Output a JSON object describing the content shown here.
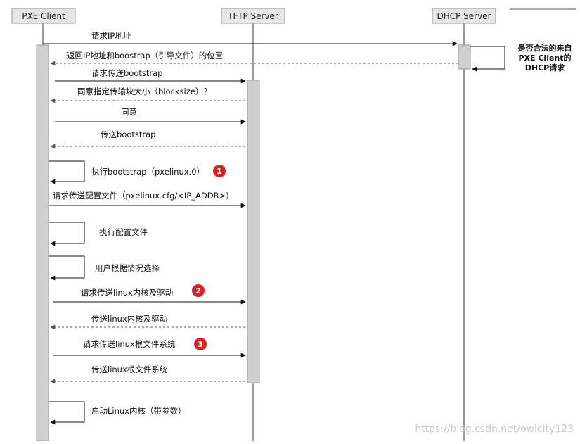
{
  "actors": [
    {
      "name": "PXE Client"
    },
    {
      "name": "TFTP Server"
    },
    {
      "name": "DHCP Server"
    }
  ],
  "messages": [
    {
      "text": "请求IP地址"
    },
    {
      "text": "返回IP地址和boostrap（引导文件）的位置"
    },
    {
      "text": "请求传送bootstrap"
    },
    {
      "text": "同意指定传输块大小（blocksize）？"
    },
    {
      "text": "同意"
    },
    {
      "text": "传送bootstrap"
    },
    {
      "text": "执行bootstrap（pxelinux.0）",
      "badge": "1"
    },
    {
      "text": "请求传送配置文件（pxelinux.cfg/<IP_ADDR>)"
    },
    {
      "text": "执行配置文件"
    },
    {
      "text": "用户根据情况选择"
    },
    {
      "text": "请求传送linux内核及驱动",
      "badge": "2"
    },
    {
      "text": "传送linux内核及驱动"
    },
    {
      "text": "请求传送linux根文件系统",
      "badge": "3"
    },
    {
      "text": "传送linux根文件系统"
    },
    {
      "text": "启动Linux内核（带参数）"
    }
  ],
  "note": {
    "lines": [
      "是否合法的来自",
      "PXE Client的",
      "DHCP请求"
    ]
  },
  "watermark": "https://blog.csdn.net/owlcity123",
  "colors": {
    "badge": "#e02020",
    "actor_fill": "#e6e6e6",
    "activation_fill": "#cfcfcf"
  }
}
